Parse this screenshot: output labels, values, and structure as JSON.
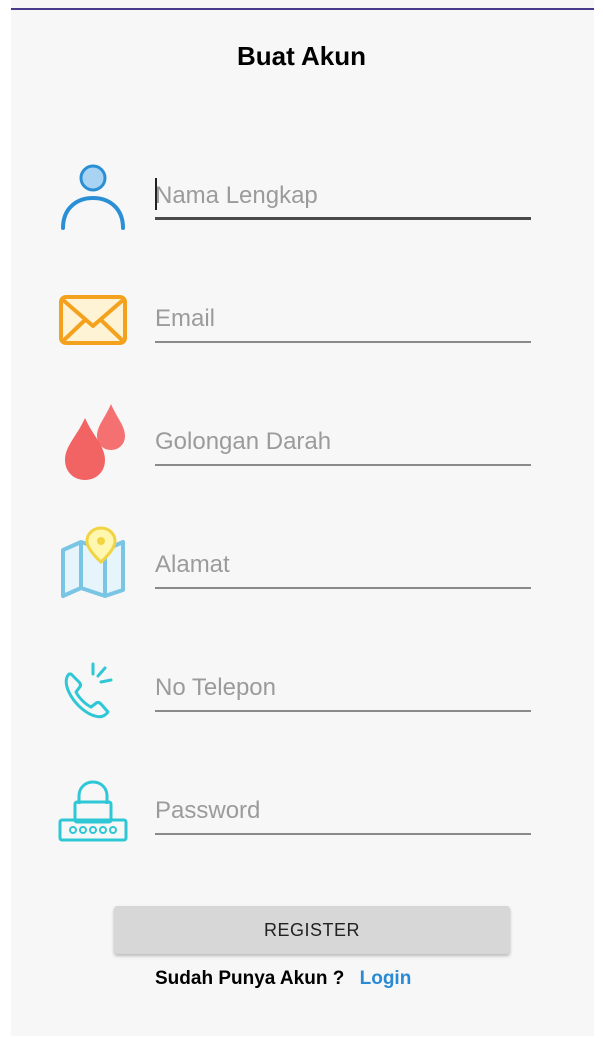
{
  "page": {
    "title": "Buat Akun"
  },
  "form": {
    "fields": [
      {
        "placeholder": "Nama Lengkap",
        "value": "",
        "icon": "user-icon"
      },
      {
        "placeholder": "Email",
        "value": "",
        "icon": "envelope-icon"
      },
      {
        "placeholder": "Golongan Darah",
        "value": "",
        "icon": "blood-drop-icon"
      },
      {
        "placeholder": "Alamat",
        "value": "",
        "icon": "map-pin-icon"
      },
      {
        "placeholder": "No Telepon",
        "value": "",
        "icon": "phone-icon"
      },
      {
        "placeholder": "Password",
        "value": "",
        "icon": "lock-icon"
      }
    ],
    "register_label": "REGISTER"
  },
  "footer": {
    "question": "Sudah Punya Akun ?",
    "login_label": "Login"
  },
  "colors": {
    "background": "#f7f7f7",
    "header_line": "#4a3a8c",
    "link": "#2a8ad4",
    "button": "#d7d7d7"
  }
}
